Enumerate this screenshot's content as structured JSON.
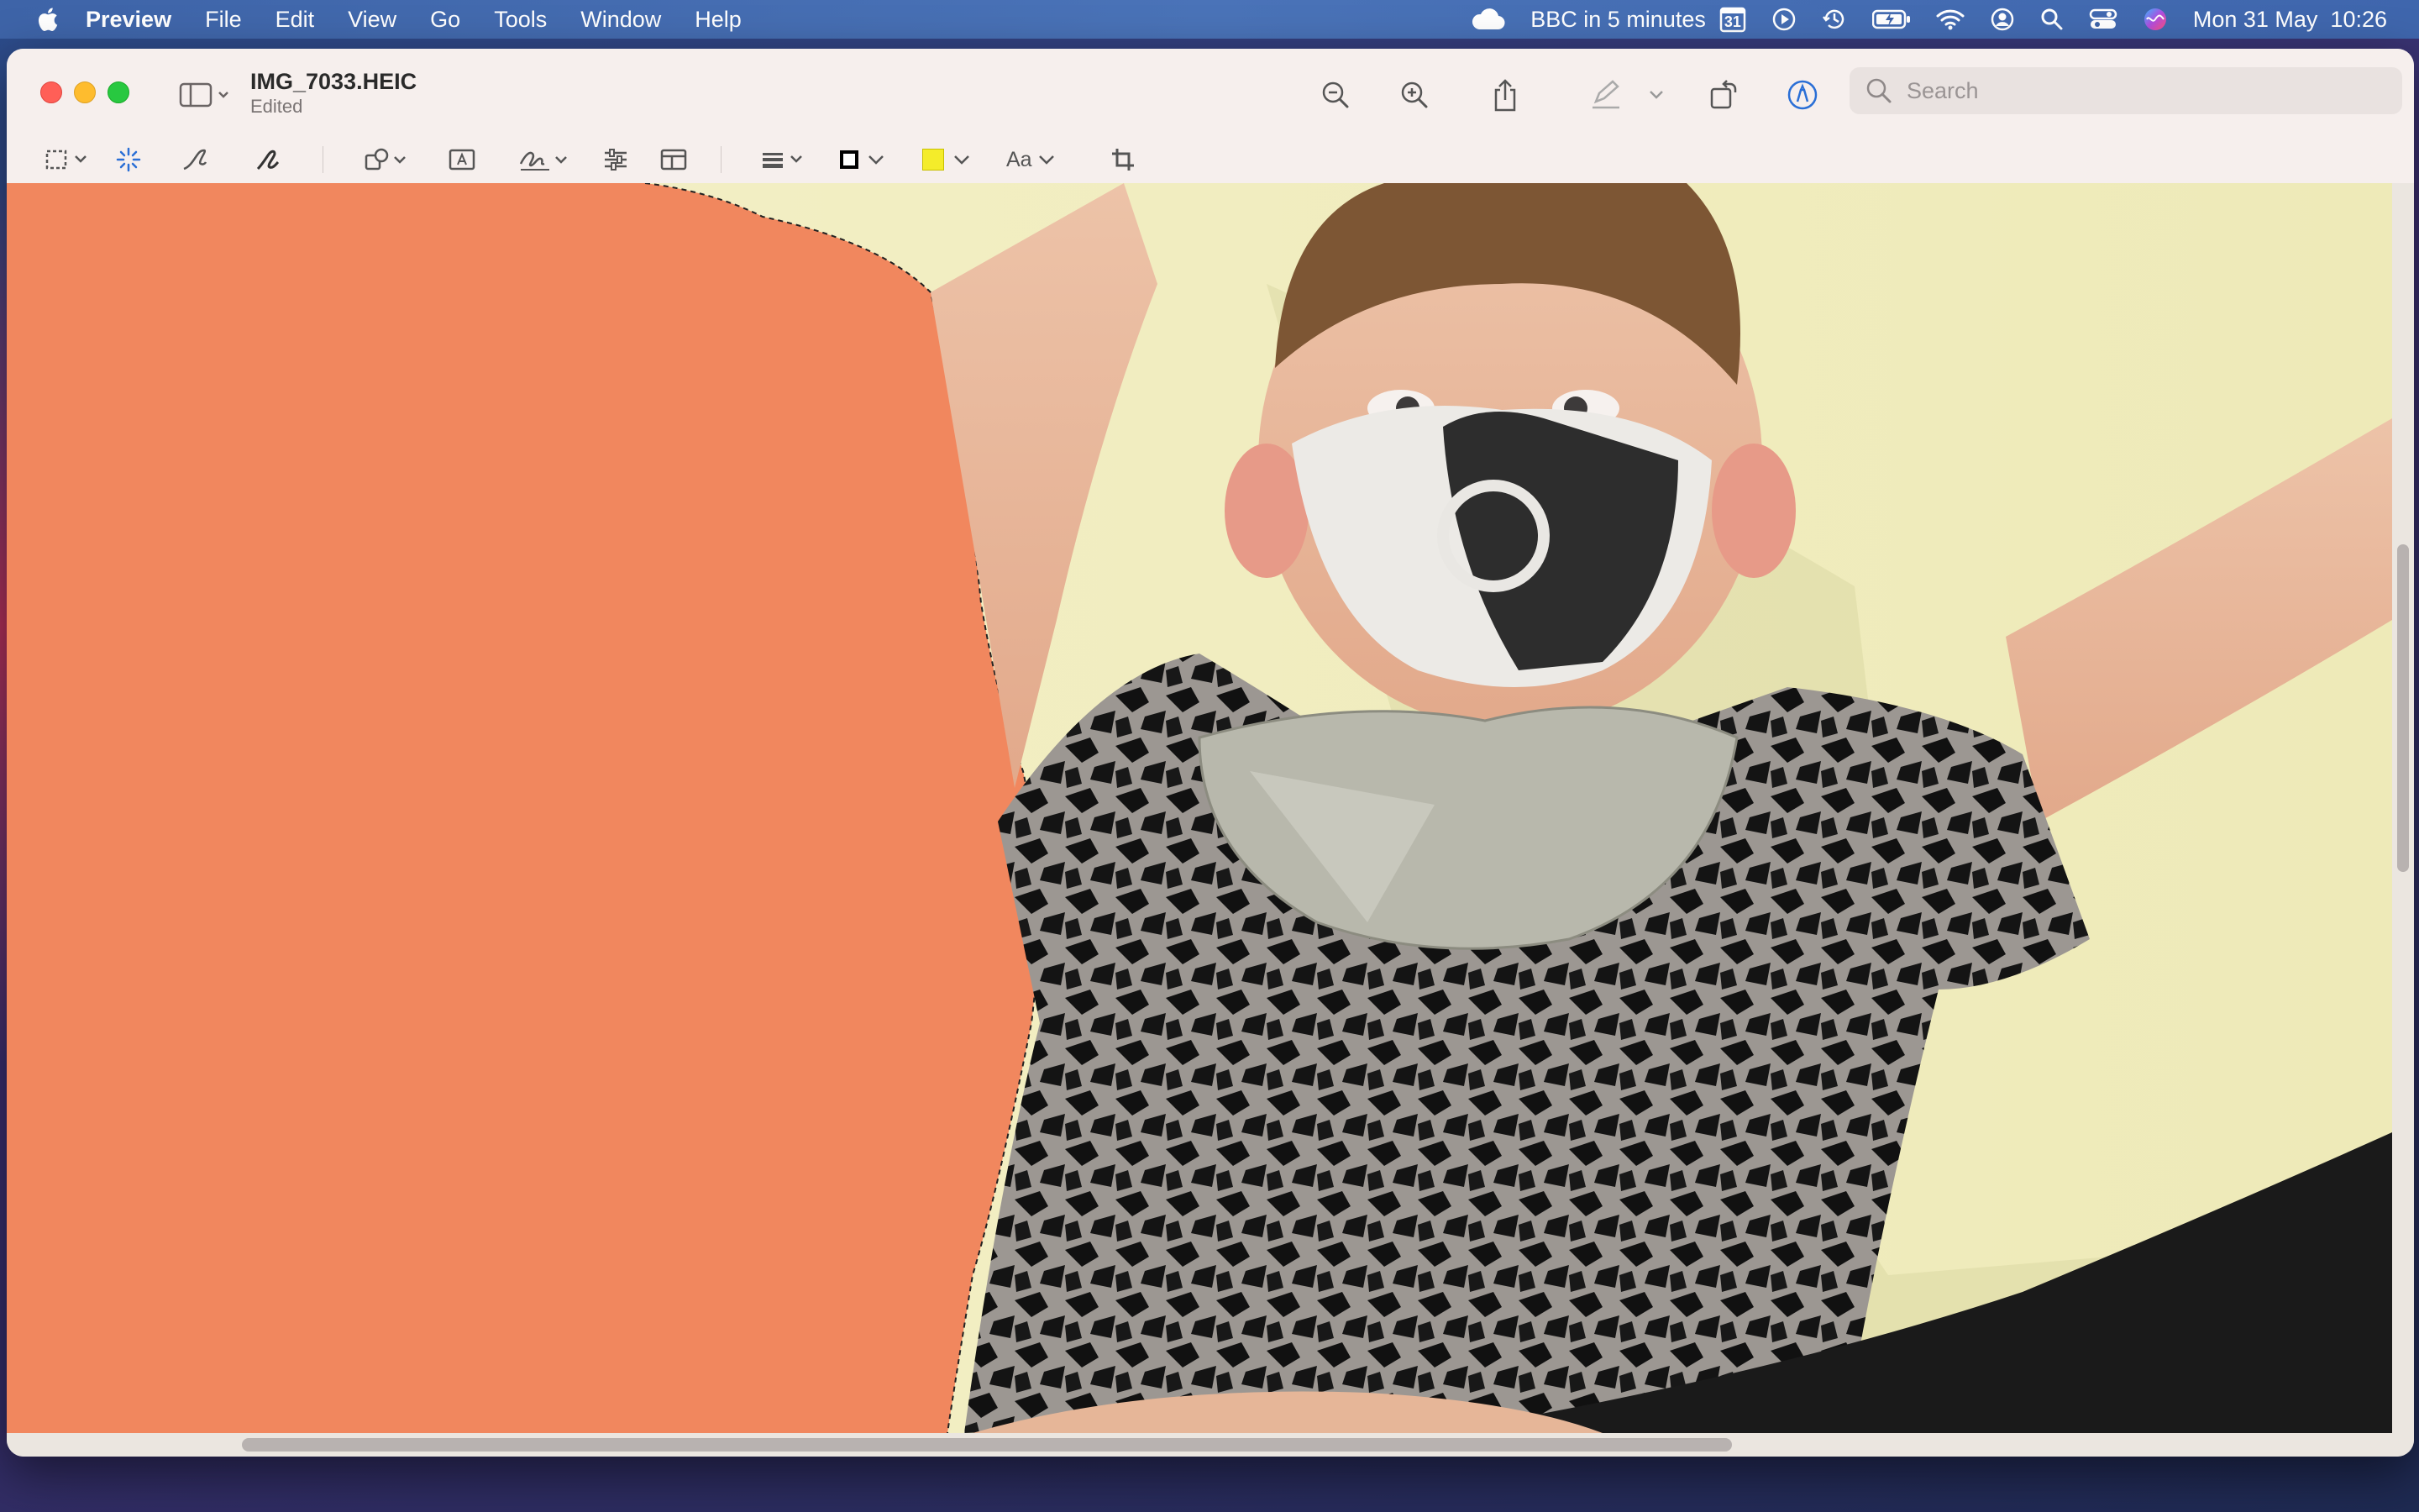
{
  "menubar": {
    "app_name": "Preview",
    "menus": [
      "File",
      "Edit",
      "View",
      "Go",
      "Tools",
      "Window",
      "Help"
    ],
    "event_text": "BBC in 5 minutes",
    "calendar_day": "31",
    "clock": "Mon 31 May  10:26"
  },
  "window": {
    "title": "IMG_7033.HEIC",
    "subtitle": "Edited",
    "search_placeholder": "Search"
  },
  "markup": {
    "text_style_label": "Aa"
  },
  "colors": {
    "fill_swatch": "#f4ec2a",
    "border_swatch": "#000000",
    "instant_alpha_fill": "#f1875e"
  },
  "icons": [
    "apple-icon",
    "cloud-icon",
    "calendar-icon",
    "play-icon",
    "time-machine-icon",
    "battery-icon",
    "wifi-icon",
    "user-icon",
    "search-icon",
    "control-center-icon",
    "siri-icon",
    "sidebar-icon",
    "zoom-out-icon",
    "zoom-in-icon",
    "share-icon",
    "highlight-icon",
    "rotate-icon",
    "markup-icon",
    "selection-icon",
    "instant-alpha-icon",
    "sketch-icon",
    "draw-icon",
    "shapes-icon",
    "text-box-icon",
    "sign-icon",
    "adjust-color-icon",
    "page-layout-icon",
    "line-style-icon",
    "crop-icon"
  ]
}
